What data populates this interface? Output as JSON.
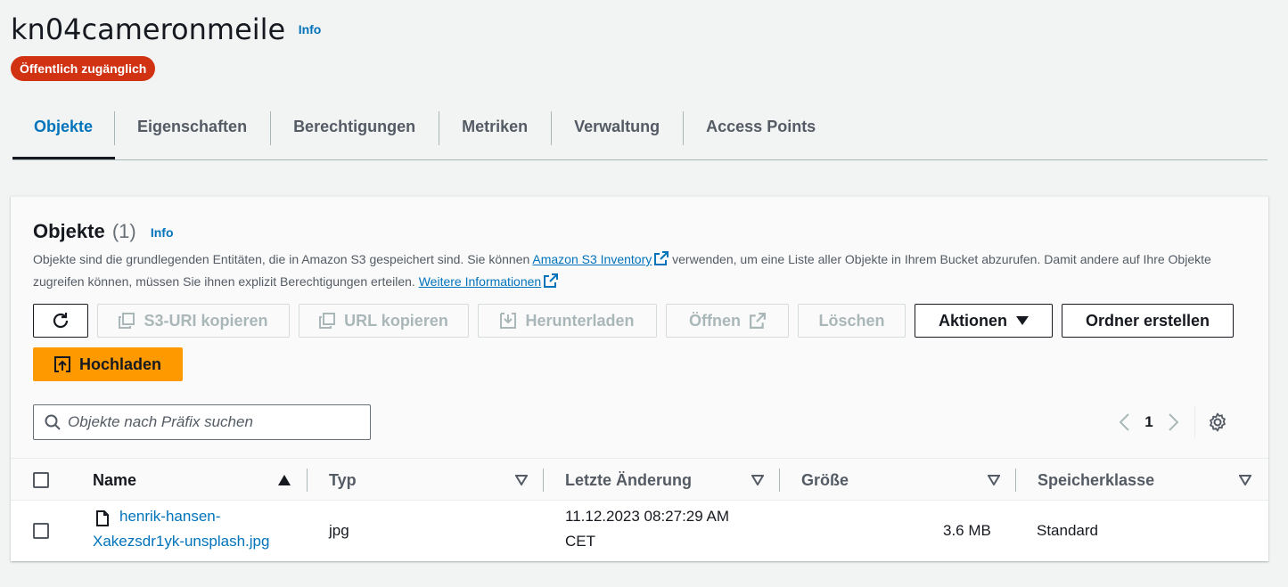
{
  "bucket": {
    "name": "kn04cameronmeile",
    "info": "Info",
    "badge": "Öffentlich zugänglich"
  },
  "tabs": [
    {
      "label": "Objekte",
      "active": true
    },
    {
      "label": "Eigenschaften"
    },
    {
      "label": "Berechtigungen"
    },
    {
      "label": "Metriken"
    },
    {
      "label": "Verwaltung"
    },
    {
      "label": "Access Points"
    }
  ],
  "panel": {
    "title": "Objekte",
    "count": "(1)",
    "info": "Info",
    "desc_part1": "Objekte sind die grundlegenden Entitäten, die in Amazon S3 gespeichert sind. Sie können ",
    "desc_link1": "Amazon S3 Inventory",
    "desc_part2": " verwenden, um eine Liste aller Objekte in Ihrem Bucket abzurufen. Damit andere auf Ihre Objekte zugreifen können, müssen Sie ihnen explizit Berechtigungen erteilen. ",
    "desc_link2": "Weitere Informationen"
  },
  "toolbar": {
    "copy_s3_uri": "S3-URI kopieren",
    "copy_url": "URL kopieren",
    "download": "Herunterladen",
    "open": "Öffnen",
    "delete": "Löschen",
    "actions": "Aktionen",
    "create_folder": "Ordner erstellen",
    "upload": "Hochladen"
  },
  "search": {
    "placeholder": "Objekte nach Präfix suchen"
  },
  "pagination": {
    "current_page": "1"
  },
  "table": {
    "columns": [
      "Name",
      "Typ",
      "Letzte Änderung",
      "Größe",
      "Speicherklasse"
    ],
    "rows": [
      {
        "name_line1": "henrik-hansen-",
        "name_line2": "Xakezsdr1yk-unsplash.jpg",
        "type": "jpg",
        "modified_line1": "11.12.2023 08:27:29 AM",
        "modified_line2": "CET",
        "size": "3.6 MB",
        "storage_class": "Standard"
      }
    ]
  },
  "colors": {
    "link": "#0073bb",
    "badge": "#d13212",
    "primary": "#ff9900"
  }
}
